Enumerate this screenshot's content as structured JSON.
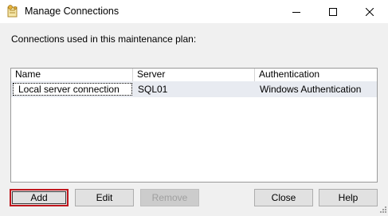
{
  "window": {
    "title": "Manage Connections"
  },
  "main": {
    "prompt": "Connections used in this maintenance plan:"
  },
  "grid": {
    "columns": [
      "Name",
      "Server",
      "Authentication"
    ],
    "rows": [
      {
        "name": "Local server connection",
        "server": "SQL01",
        "authentication": "Windows Authentication"
      }
    ]
  },
  "buttons": {
    "add": "Add",
    "edit": "Edit",
    "remove": "Remove",
    "close": "Close",
    "help": "Help"
  },
  "colors": {
    "highlight_border": "#c0161d",
    "selected_row": "#e8ebf1",
    "dialog_background": "#f0f0f0"
  }
}
